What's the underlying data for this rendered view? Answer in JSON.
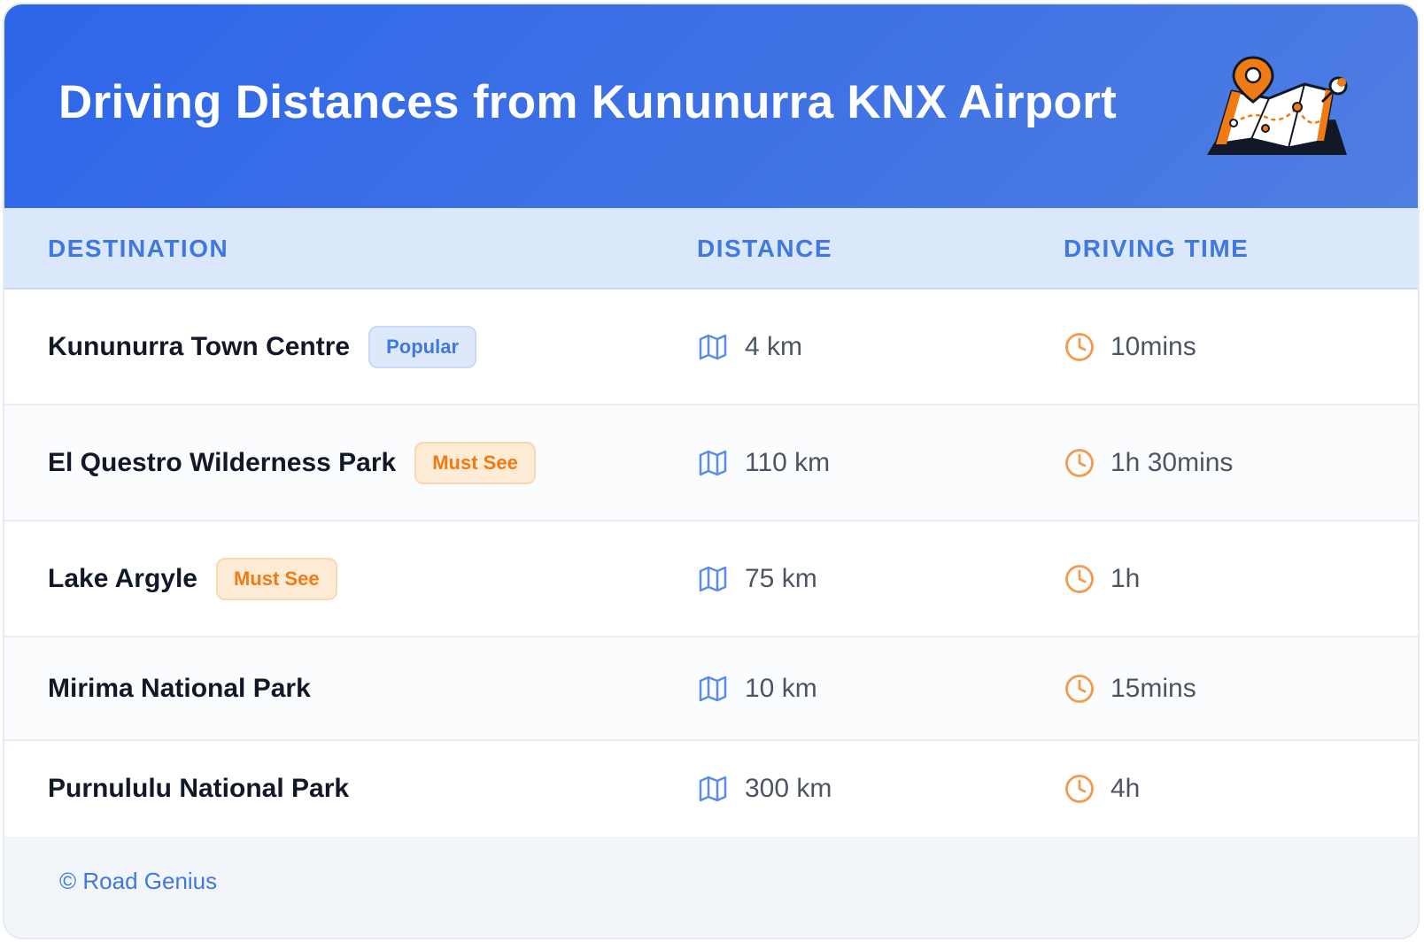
{
  "header": {
    "title": "Driving Distances from Kununurra KNX Airport",
    "illustration_icon": "map-location-pin-icon"
  },
  "table": {
    "columns": [
      "DESTINATION",
      "DISTANCE",
      "DRIVING TIME"
    ],
    "rows": [
      {
        "destination": "Kununurra Town Centre",
        "badge": "Popular",
        "badge_style": "blue",
        "distance": "4 km",
        "time": "10mins"
      },
      {
        "destination": "El Questro Wilderness Park",
        "badge": "Must See",
        "badge_style": "orange",
        "distance": "110 km",
        "time": "1h 30mins"
      },
      {
        "destination": "Lake Argyle",
        "badge": "Must See",
        "badge_style": "orange",
        "distance": "75 km",
        "time": "1h"
      },
      {
        "destination": "Mirima National Park",
        "badge": "",
        "badge_style": "",
        "distance": "10 km",
        "time": "15mins"
      },
      {
        "destination": "Purnululu National Park",
        "badge": "",
        "badge_style": "",
        "distance": "300 km",
        "time": "4h"
      }
    ],
    "distance_icon": "map-icon",
    "time_icon": "clock-icon"
  },
  "footer": {
    "credit": "© Road Genius"
  },
  "colors": {
    "header_blue": "#2d66ea",
    "accent_blue": "#3f78df",
    "accent_orange": "#f07a14"
  }
}
